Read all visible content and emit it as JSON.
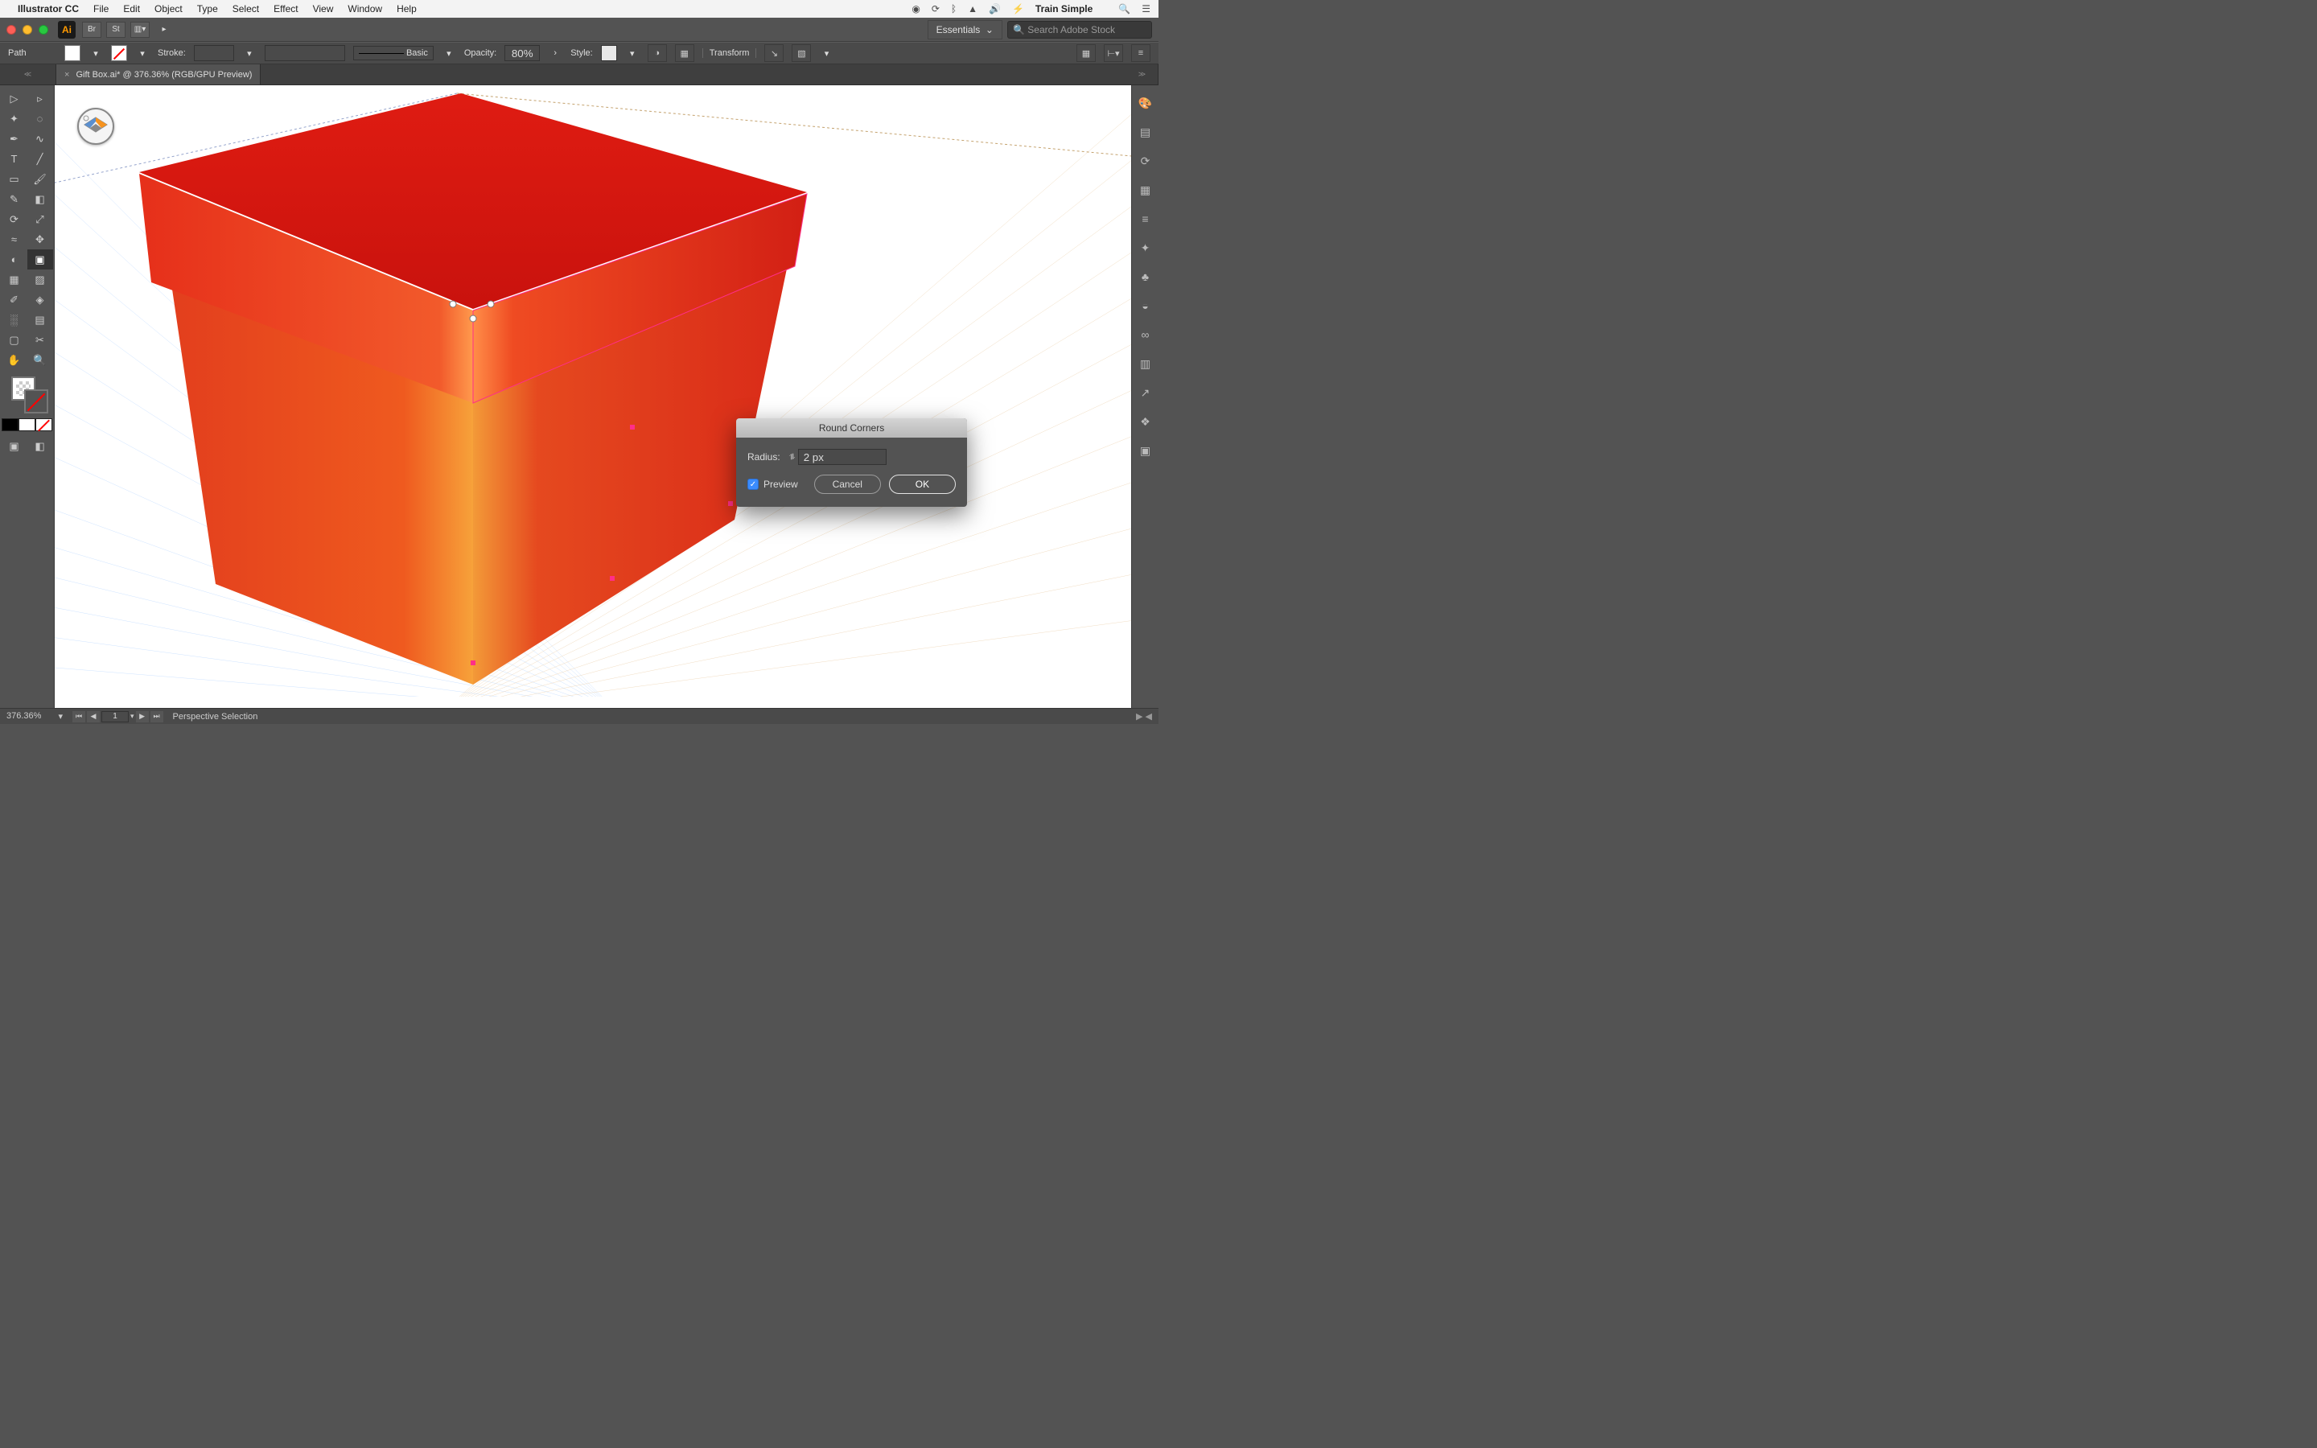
{
  "mac_menu": {
    "app_name": "Illustrator CC",
    "items": [
      "File",
      "Edit",
      "Object",
      "Type",
      "Select",
      "Effect",
      "View",
      "Window",
      "Help"
    ],
    "right_user": "Train Simple"
  },
  "appbar": {
    "workspace_label": "Essentials",
    "search_placeholder": "Search Adobe Stock",
    "br_label": "Br",
    "st_label": "St"
  },
  "ctrl": {
    "selection_label": "Path",
    "stroke_label": "Stroke:",
    "brush_label": "Basic",
    "opacity_label": "Opacity:",
    "opacity_value": "80%",
    "style_label": "Style:",
    "transform_label": "Transform"
  },
  "tab": {
    "title": "Gift Box.ai* @ 376.36% (RGB/GPU Preview)"
  },
  "dialog": {
    "title": "Round Corners",
    "radius_label": "Radius:",
    "radius_value": "2 px",
    "preview_label": "Preview",
    "preview_checked": true,
    "cancel": "Cancel",
    "ok": "OK"
  },
  "status": {
    "zoom": "376.36%",
    "artboard": "1",
    "tool_label": "Perspective Selection"
  },
  "right_icons": [
    "palette-icon",
    "file-icon",
    "refresh-icon",
    "panels-icon",
    "fx-icon",
    "wand-icon",
    "club-icon",
    "people-icon",
    "cc-icon",
    "grid-icon",
    "export-icon",
    "layers-icon",
    "artboards-icon"
  ]
}
